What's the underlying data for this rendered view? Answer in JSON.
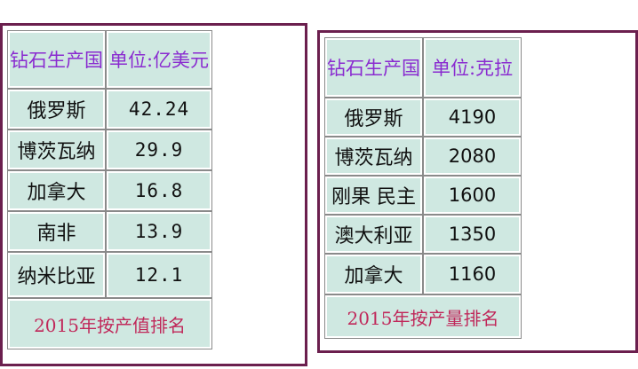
{
  "left_table": {
    "header": {
      "country": "钻石生产国",
      "unit": "单位:亿美元"
    },
    "rows": [
      {
        "country": "俄罗斯",
        "value": "42.24"
      },
      {
        "country": "博茨瓦纳",
        "value": "29.9"
      },
      {
        "country": "加拿大",
        "value": "16.8"
      },
      {
        "country": "南非",
        "value": "13.9"
      },
      {
        "country": "纳米比亚",
        "value": "12.1"
      }
    ],
    "footer": "2015年按产值排名"
  },
  "right_table": {
    "header": {
      "country": "钻石生产国",
      "unit": "单位:克拉"
    },
    "rows": [
      {
        "country": "俄罗斯",
        "value": "4190"
      },
      {
        "country": "博茨瓦纳",
        "value": "2080"
      },
      {
        "country": "刚果 民主",
        "value": "1600"
      },
      {
        "country": "澳大利亚",
        "value": "1350"
      },
      {
        "country": "加拿大",
        "value": "1160"
      }
    ],
    "footer": "2015年按产量排名"
  },
  "colors": {
    "border": "#6b1f4e",
    "cell_bg": "#cfe8e1",
    "header_text": "#8a2bd0",
    "footer_text": "#c0285a"
  }
}
